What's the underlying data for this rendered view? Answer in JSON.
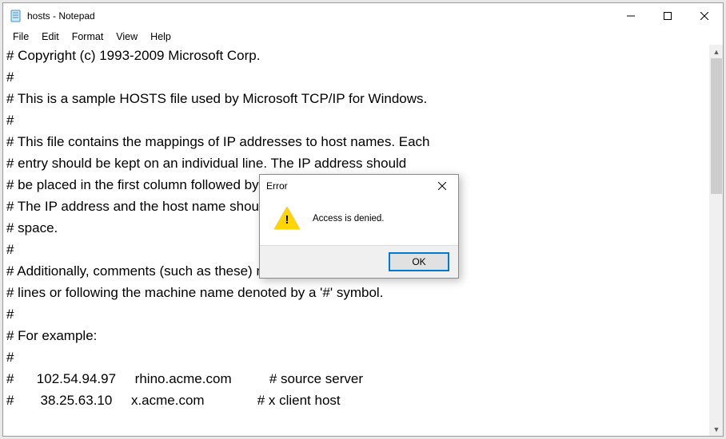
{
  "window": {
    "title": "hosts - Notepad"
  },
  "menubar": {
    "file": "File",
    "edit": "Edit",
    "format": "Format",
    "view": "View",
    "help": "Help"
  },
  "editor_lines": [
    "# Copyright (c) 1993-2009 Microsoft Corp.",
    "#",
    "# This is a sample HOSTS file used by Microsoft TCP/IP for Windows.",
    "#",
    "# This file contains the mappings of IP addresses to host names. Each",
    "# entry should be kept on an individual line. The IP address should",
    "# be placed in the first column followed by the corresponding host name.",
    "# The IP address and the host name should be separated by at least one",
    "# space.",
    "#",
    "# Additionally, comments (such as these) may be inserted on individual",
    "# lines or following the machine name denoted by a '#' symbol.",
    "#",
    "# For example:",
    "#",
    "#      102.54.94.97     rhino.acme.com          # source server",
    "#       38.25.63.10     x.acme.com              # x client host"
  ],
  "dialog": {
    "title": "Error",
    "message": "Access is denied.",
    "ok_label": "OK"
  }
}
